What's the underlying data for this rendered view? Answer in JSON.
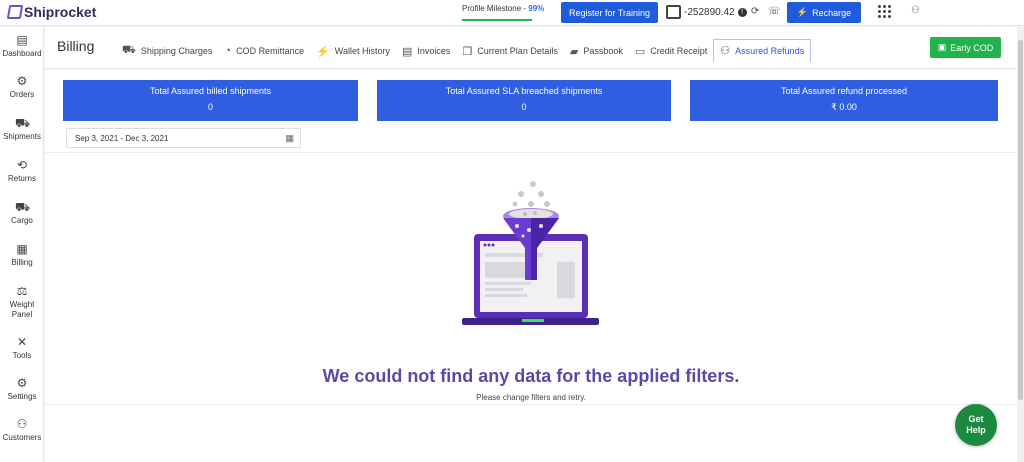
{
  "brand": {
    "name": "Shiprocket"
  },
  "topbar": {
    "milestone_label": "Profile Milestone - ",
    "milestone_value": "99%",
    "milestone_progress": 0.99,
    "register_label": "Register for Training",
    "wallet_balance": "-252890.42",
    "recharge_label": "Recharge"
  },
  "sidebar": {
    "items": [
      {
        "label": "Dashboard",
        "icon": "dashboard-icon",
        "glyph": "▤"
      },
      {
        "label": "Orders",
        "icon": "orders-icon",
        "glyph": "⚙"
      },
      {
        "label": "Shipments",
        "icon": "shipments-icon",
        "glyph": "⛟"
      },
      {
        "label": "Returns",
        "icon": "returns-icon",
        "glyph": "⟲"
      },
      {
        "label": "Cargo",
        "icon": "cargo-icon",
        "glyph": "⛟"
      },
      {
        "label": "Billing",
        "icon": "billing-icon",
        "glyph": "▦"
      },
      {
        "label": "Weight",
        "label2": "Panel",
        "icon": "weight-icon",
        "glyph": "⚖"
      },
      {
        "label": "Tools",
        "icon": "tools-icon",
        "glyph": "✕"
      },
      {
        "label": "Settings",
        "icon": "settings-icon",
        "glyph": "⚙"
      },
      {
        "label": "Customers",
        "icon": "customers-icon",
        "glyph": "⚇"
      }
    ]
  },
  "header": {
    "title": "Billing",
    "tabs": [
      {
        "label": "Shipping Charges",
        "icon": "truck-icon",
        "glyph": "⛟"
      },
      {
        "label": "COD Remittance",
        "icon": "coins-icon",
        "glyph": "◔"
      },
      {
        "label": "Wallet History",
        "icon": "bolt-icon",
        "glyph": "⚡"
      },
      {
        "label": "Invoices",
        "icon": "invoice-icon",
        "glyph": "▤"
      },
      {
        "label": "Current Plan Details",
        "icon": "copy-icon",
        "glyph": "❐"
      },
      {
        "label": "Passbook",
        "icon": "book-icon",
        "glyph": "▰"
      },
      {
        "label": "Credit Receipt",
        "icon": "receipt-icon",
        "glyph": "▭"
      },
      {
        "label": "Assured Refunds",
        "icon": "refund-icon",
        "glyph": "⚇",
        "active": true
      }
    ],
    "early_cod_label": "Early COD"
  },
  "stats": [
    {
      "label": "Total Assured billed shipments",
      "value": "0"
    },
    {
      "label": "Total Assured SLA breached shipments",
      "value": "0"
    },
    {
      "label": "Total Assured refund processed",
      "value": "₹  0.00"
    }
  ],
  "filter": {
    "date_range": "Sep 3, 2021 - Dec 3, 2021"
  },
  "empty_state": {
    "title": "We could not find any data for the applied filters.",
    "subtitle": "Please change filters and retry."
  },
  "help": {
    "line1": "Get",
    "line2": "Help"
  },
  "colors": {
    "accent": "#1f5bdc",
    "stat_bg": "#2f5ee0",
    "empty_title": "#5a4aa8",
    "success": "#21b24b"
  }
}
